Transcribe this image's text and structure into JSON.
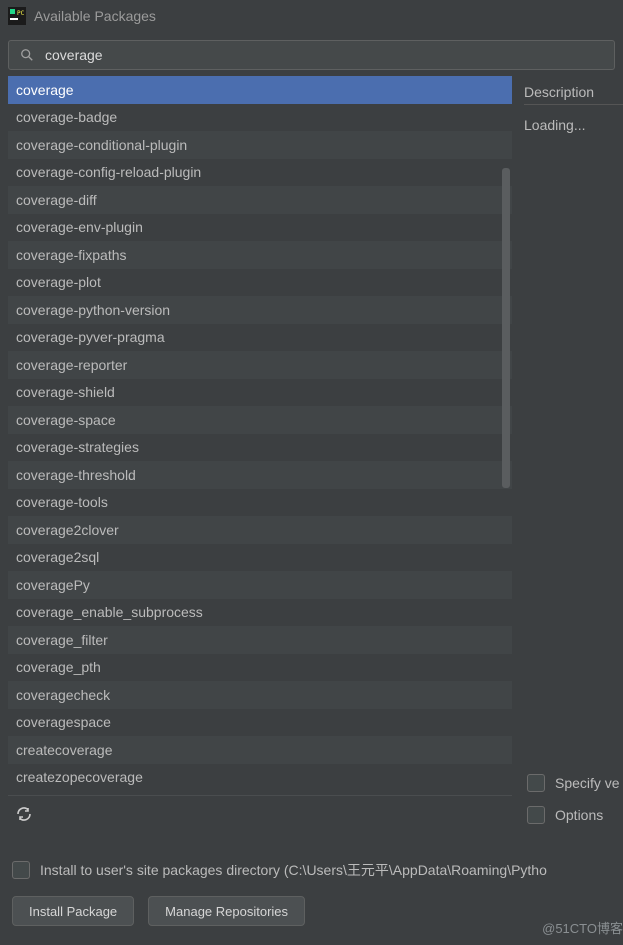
{
  "window": {
    "title": "Available Packages"
  },
  "search": {
    "value": "coverage"
  },
  "packages": [
    {
      "name": "coverage",
      "selected": true
    },
    {
      "name": "coverage-badge"
    },
    {
      "name": "coverage-conditional-plugin"
    },
    {
      "name": "coverage-config-reload-plugin"
    },
    {
      "name": "coverage-diff"
    },
    {
      "name": "coverage-env-plugin"
    },
    {
      "name": "coverage-fixpaths"
    },
    {
      "name": "coverage-plot"
    },
    {
      "name": "coverage-python-version"
    },
    {
      "name": "coverage-pyver-pragma"
    },
    {
      "name": "coverage-reporter"
    },
    {
      "name": "coverage-shield"
    },
    {
      "name": "coverage-space"
    },
    {
      "name": "coverage-strategies"
    },
    {
      "name": "coverage-threshold"
    },
    {
      "name": "coverage-tools"
    },
    {
      "name": "coverage2clover"
    },
    {
      "name": "coverage2sql"
    },
    {
      "name": "coveragePy"
    },
    {
      "name": "coverage_enable_subprocess"
    },
    {
      "name": "coverage_filter"
    },
    {
      "name": "coverage_pth"
    },
    {
      "name": "coveragecheck"
    },
    {
      "name": "coveragespace"
    },
    {
      "name": "createcoverage"
    },
    {
      "name": "createzopecoverage"
    }
  ],
  "right_panel": {
    "description_label": "Description",
    "loading": "Loading...",
    "specify_version_label": "Specify ve",
    "options_label": "Options"
  },
  "bottom": {
    "install_user_site_label": "Install to user's site packages directory (C:\\Users\\王元平\\AppData\\Roaming\\Pytho",
    "install_button": "Install Package",
    "manage_repos_button": "Manage Repositories"
  },
  "watermark": "@51CTO博客"
}
